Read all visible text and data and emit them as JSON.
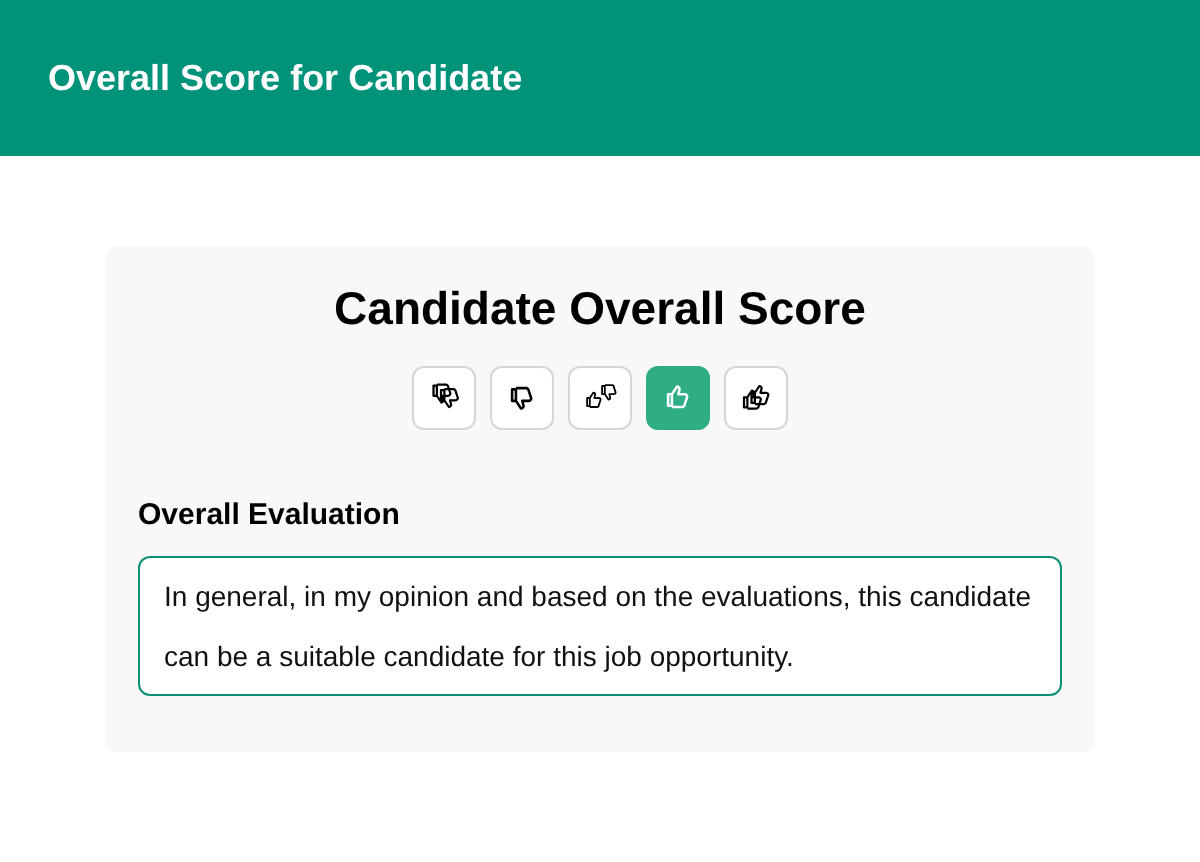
{
  "header": {
    "title": "Overall Score for Candidate"
  },
  "card": {
    "title": "Candidate Overall Score",
    "ratings": [
      {
        "kind": "double-down",
        "selected": false
      },
      {
        "kind": "down",
        "selected": false
      },
      {
        "kind": "mixed",
        "selected": false
      },
      {
        "kind": "up",
        "selected": true
      },
      {
        "kind": "double-up",
        "selected": false
      }
    ],
    "evaluation": {
      "label": "Overall Evaluation",
      "value": "In general, in my opinion and based on the evaluations, this candidate can be a suitable candidate for this job opportunity."
    }
  }
}
